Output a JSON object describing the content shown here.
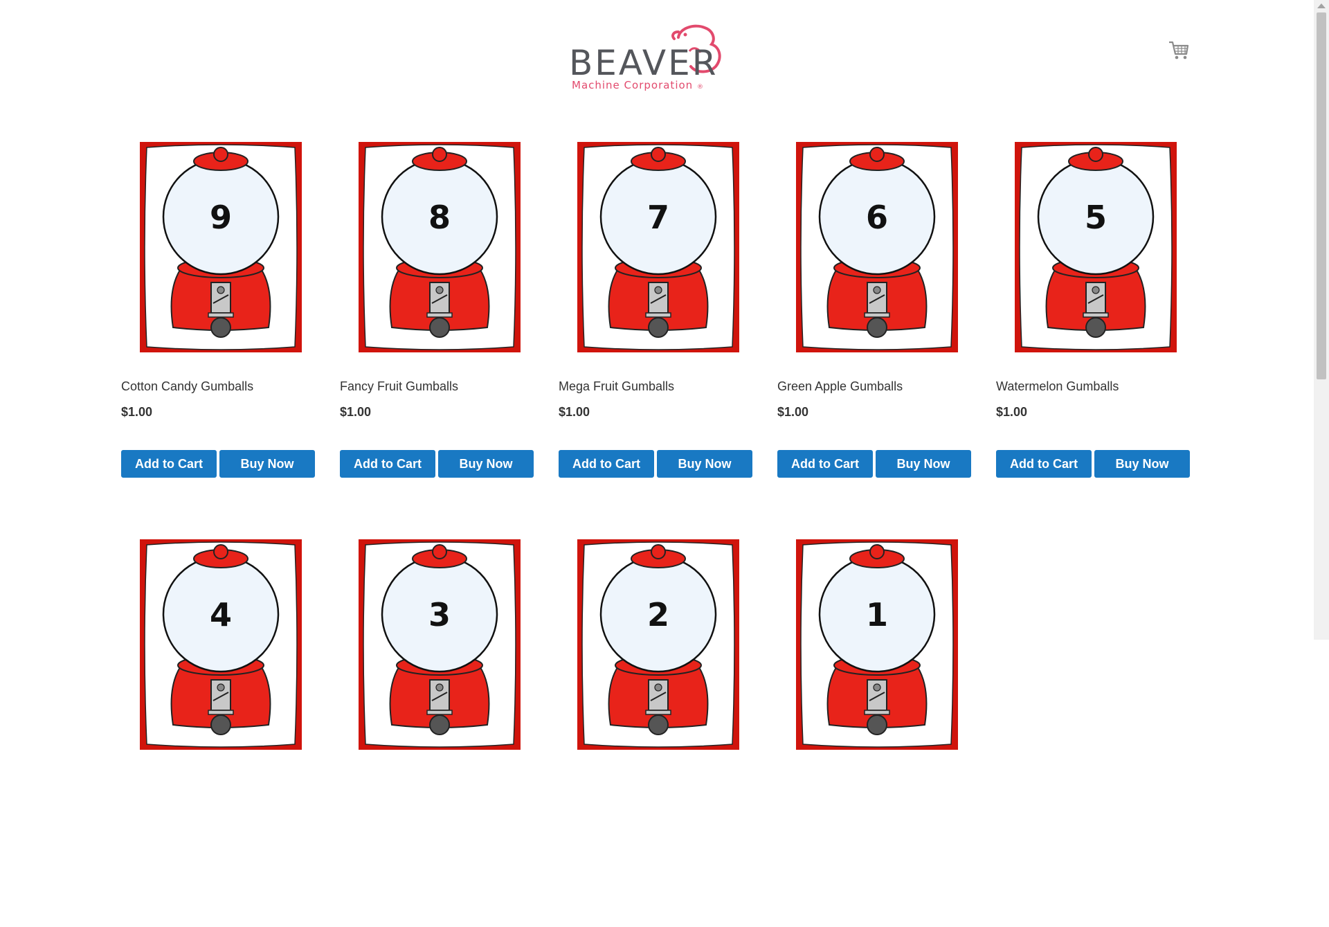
{
  "brand": {
    "name": "BEAVER",
    "tagline": "Machine Corporation",
    "trademark": "®",
    "colors": {
      "text": "#54565b",
      "accent": "#e24a6d"
    }
  },
  "cart": {
    "icon": "shopping-cart-icon"
  },
  "theme": {
    "button_color": "#1979c3",
    "card_frame_color": "#d0140c",
    "machine_red": "#e8231a"
  },
  "products": [
    {
      "image_number": "9",
      "name": "Cotton Candy Gumballs",
      "price": "$1.00",
      "add_label": "Add to Cart",
      "buy_label": "Buy Now"
    },
    {
      "image_number": "8",
      "name": "Fancy Fruit Gumballs",
      "price": "$1.00",
      "add_label": "Add to Cart",
      "buy_label": "Buy Now"
    },
    {
      "image_number": "7",
      "name": "Mega Fruit Gumballs",
      "price": "$1.00",
      "add_label": "Add to Cart",
      "buy_label": "Buy Now"
    },
    {
      "image_number": "6",
      "name": "Green Apple Gumballs",
      "price": "$1.00",
      "add_label": "Add to Cart",
      "buy_label": "Buy Now"
    },
    {
      "image_number": "5",
      "name": "Watermelon Gumballs",
      "price": "$1.00",
      "add_label": "Add to Cart",
      "buy_label": "Buy Now"
    },
    {
      "image_number": "4"
    },
    {
      "image_number": "3"
    },
    {
      "image_number": "2"
    },
    {
      "image_number": "1"
    }
  ]
}
